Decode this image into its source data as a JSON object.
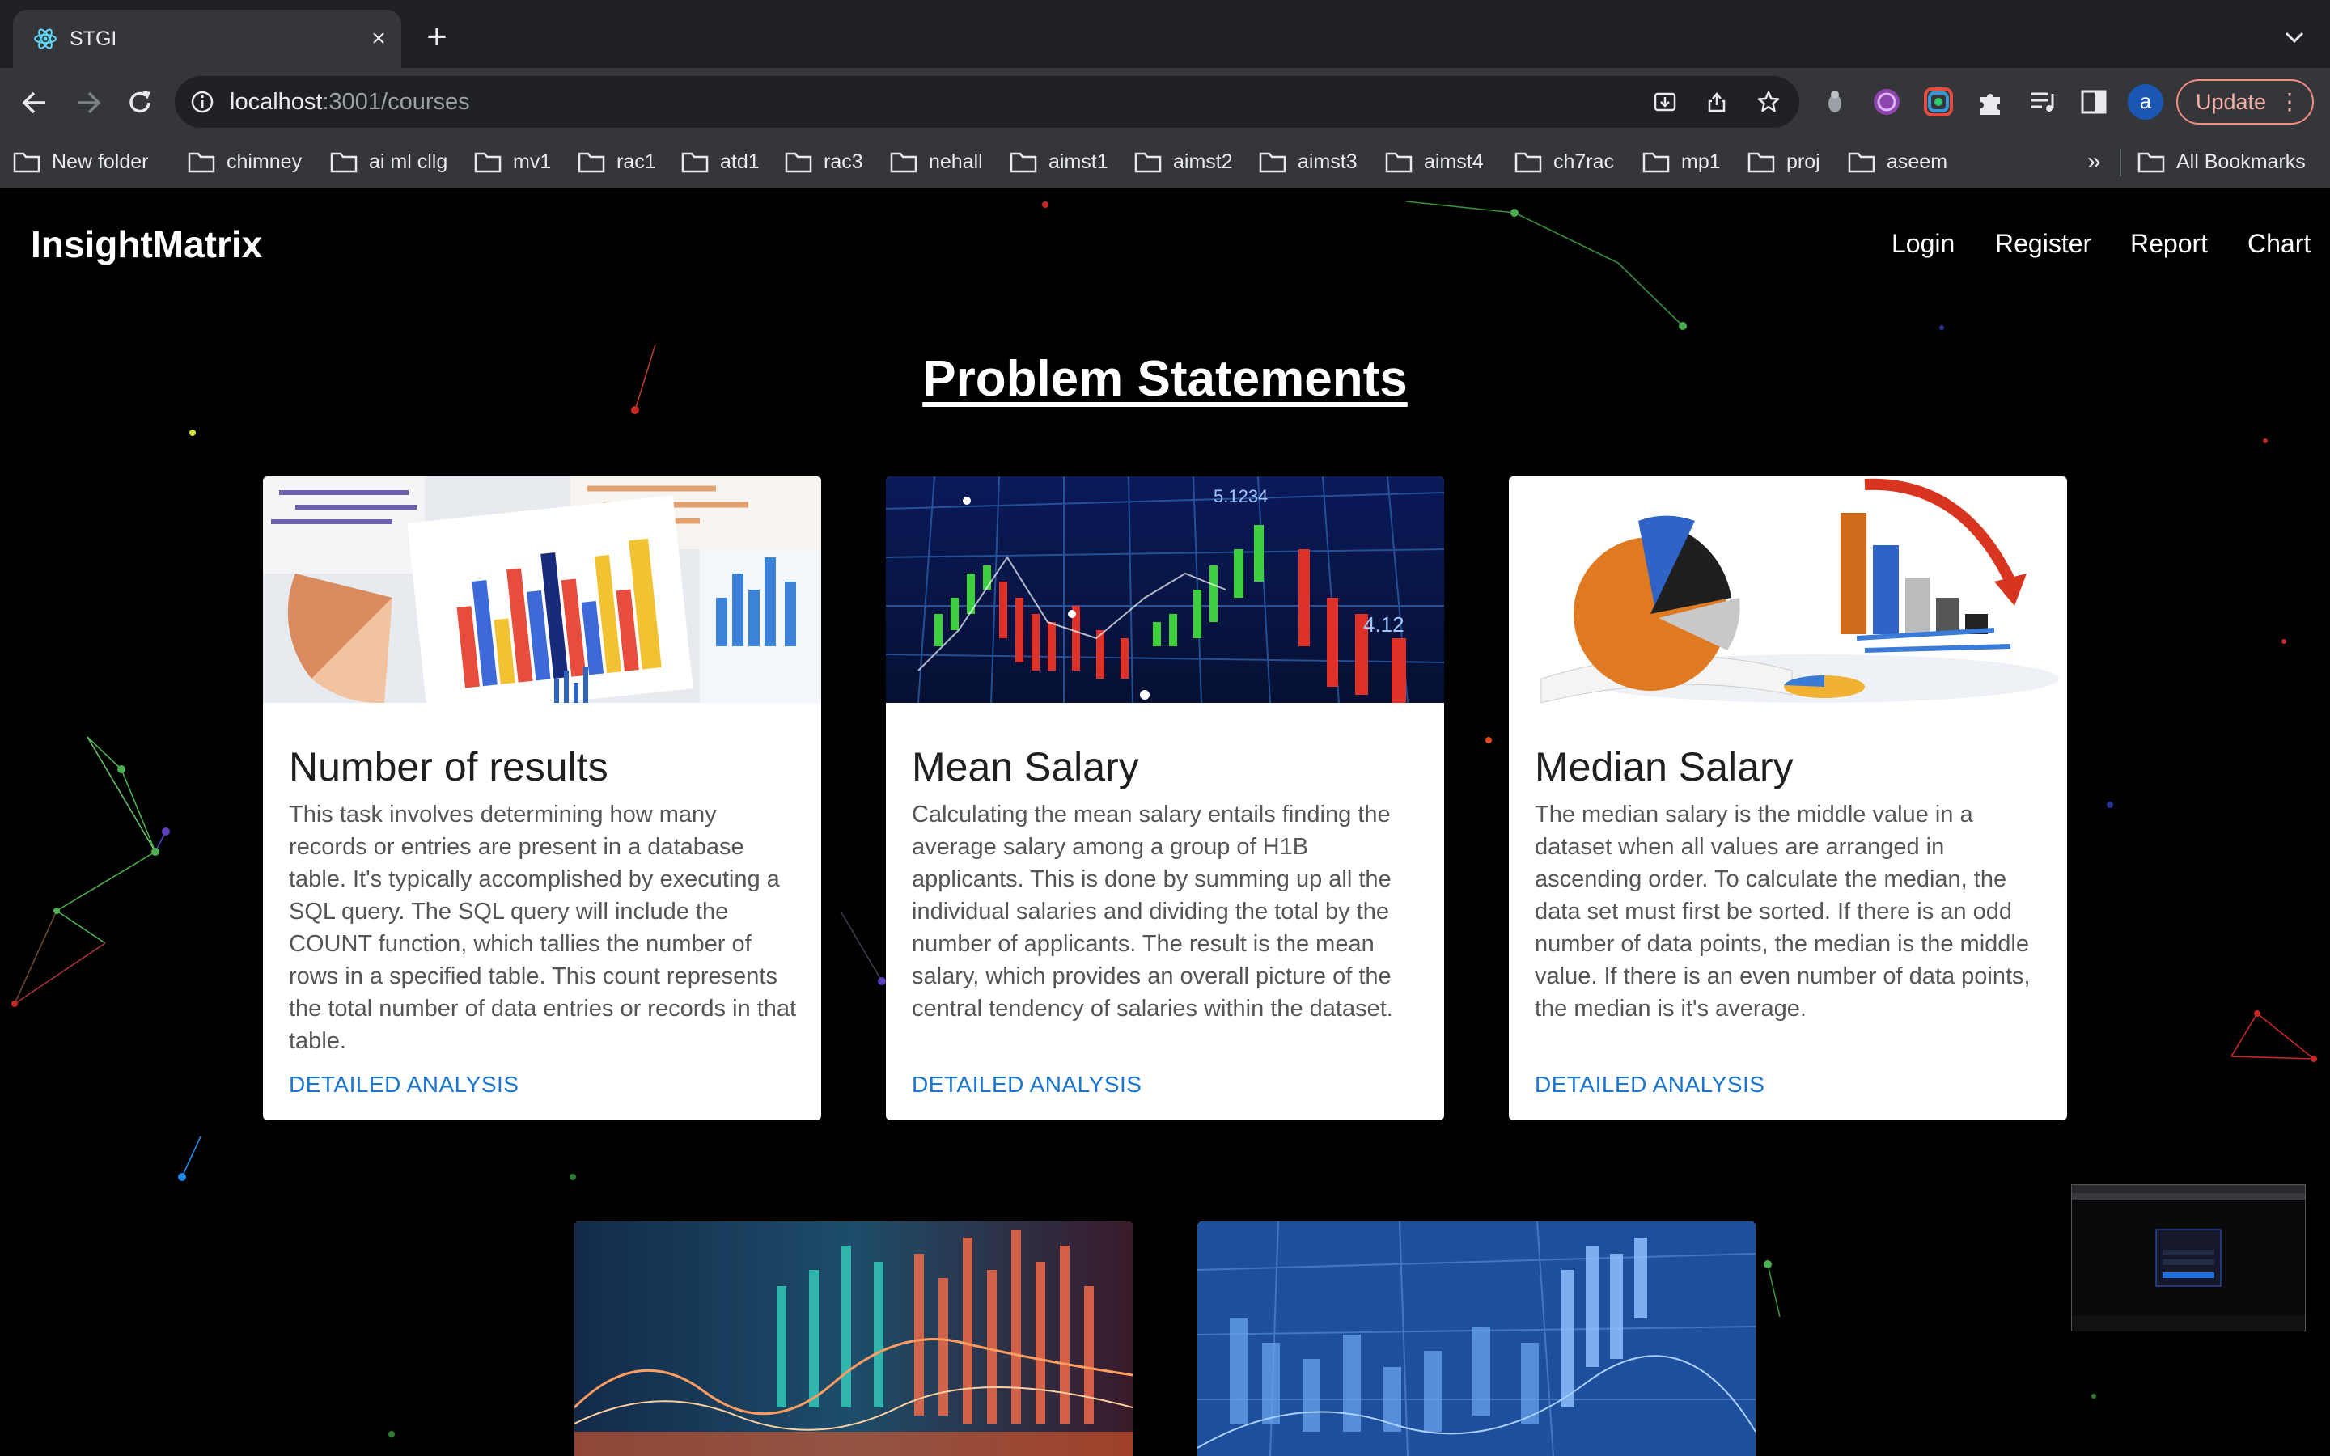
{
  "browser": {
    "tab_title": "STGI",
    "url_host": "localhost",
    "url_path": ":3001/courses",
    "update_label": "Update",
    "profile_initial": "a",
    "bookmarks": [
      "New folder",
      "chimney",
      "ai ml cllg",
      "mv1",
      "rac1",
      "atd1",
      "rac3",
      "nehall",
      "aimst1",
      "aimst2",
      "aimst3",
      "aimst4",
      "ch7rac",
      "mp1",
      "proj",
      "aseem"
    ],
    "overflow_chevron": "»",
    "all_bookmarks": "All Bookmarks"
  },
  "app": {
    "brand": "InsightMatrix",
    "nav": [
      "Login",
      "Register",
      "Report",
      "Chart"
    ],
    "heading": "Problem Statements"
  },
  "cards": [
    {
      "title": "Number of results",
      "text": "This task involves determining how many records or entries are present in a database table. It's typically accomplished by executing a SQL query. The SQL query will include the COUNT function, which tallies the number of rows in a specified table. This count represents the total number of data entries or records in that table.",
      "action": "DETAILED ANALYSIS"
    },
    {
      "title": "Mean Salary",
      "text": "Calculating the mean salary entails finding the average salary among a group of H1B applicants. This is done by summing up all the individual salaries and dividing the total by the number of applicants. The result is the mean salary, which provides an overall picture of the central tendency of salaries within the dataset.",
      "action": "DETAILED ANALYSIS"
    },
    {
      "title": "Median Salary",
      "text": "The median salary is the middle value in a dataset when all values are arranged in ascending order. To calculate the median, the data set must first be sorted. If there is an odd number of data points, the median is the middle value. If there is an even number of data points, the median is it's average.",
      "action": "DETAILED ANALYSIS"
    }
  ],
  "image_text": {
    "mean_top": "5.1234",
    "mean_right": "4.12"
  },
  "colors": {
    "page_bg": "#000000",
    "card_bg": "#ffffff",
    "action_link": "#1976d2",
    "chrome_dark": "#202124",
    "chrome": "#35363a"
  }
}
